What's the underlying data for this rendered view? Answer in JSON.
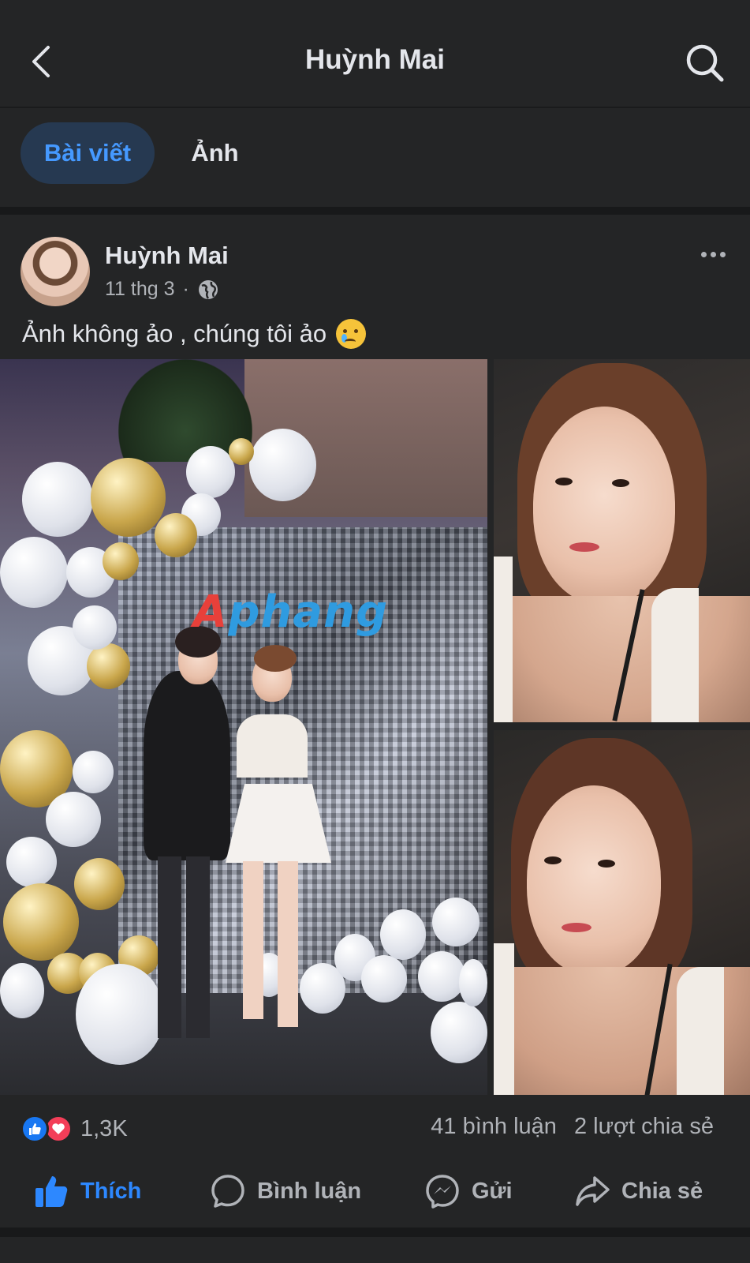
{
  "header": {
    "title": "Huỳnh Mai",
    "back_icon": "chevron-left-icon",
    "search_icon": "search-icon"
  },
  "tabs": [
    {
      "label": "Bài viết",
      "active": true
    },
    {
      "label": "Ảnh",
      "active": false
    }
  ],
  "post": {
    "author": "Huỳnh Mai",
    "date": "11 thg 3",
    "separator": "·",
    "privacy_icon": "globe-icon",
    "text": "Ảnh không ảo , chúng tôi ảo",
    "emoji": "crying-face-emoji",
    "photos": [
      {
        "name": "party-photo",
        "watermark": "Aphang"
      },
      {
        "name": "selfie-photo-1"
      },
      {
        "name": "selfie-photo-2"
      }
    ]
  },
  "stats": {
    "reaction_count": "1,3K",
    "comments": "41 bình luận",
    "shares": "2 lượt chia sẻ"
  },
  "actions": {
    "like": "Thích",
    "comment": "Bình luận",
    "send": "Gửi",
    "share": "Chia sẻ"
  },
  "colors": {
    "background": "#242526",
    "accent": "#2d88ff",
    "tab_active_bg": "#263951",
    "like_blue": "#1877f2",
    "love_red": "#f33e58"
  }
}
